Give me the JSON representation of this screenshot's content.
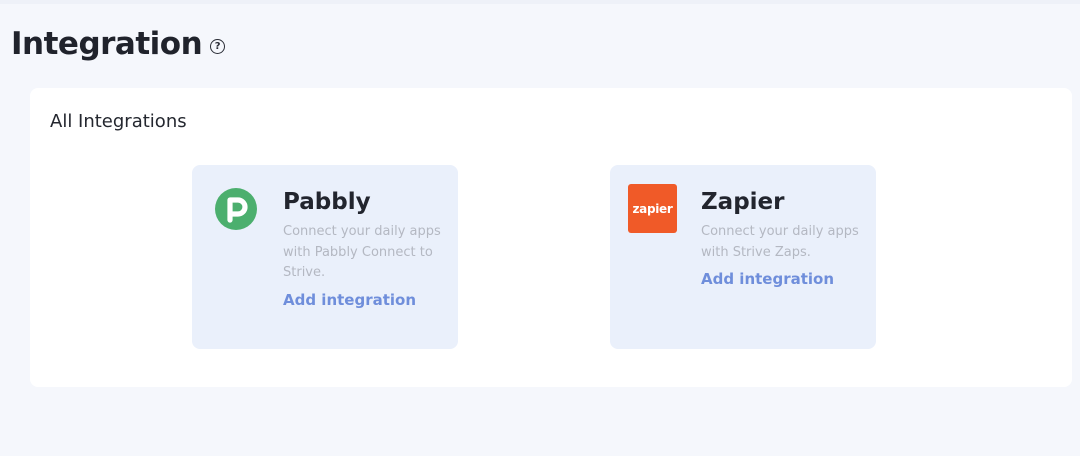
{
  "page": {
    "title": "Integration",
    "help_icon": "?"
  },
  "panel": {
    "title": "All Integrations"
  },
  "integrations": [
    {
      "name": "Pabbly",
      "description": "Connect your daily apps with Pabbly Connect to Strive.",
      "action_label": "Add integration",
      "logo_icon": "pabbly-logo-icon",
      "logo_color": "#4caf6e"
    },
    {
      "name": "Zapier",
      "description": "Connect your daily apps with Strive Zaps.",
      "action_label": "Add integration",
      "logo_icon": "zapier-logo-icon",
      "logo_text": "zapier",
      "logo_color": "#f05a28"
    }
  ],
  "colors": {
    "background": "#f5f7fc",
    "card_background": "#eaf0fb",
    "link": "#6f8edb",
    "muted_text": "#b4b8c2"
  }
}
